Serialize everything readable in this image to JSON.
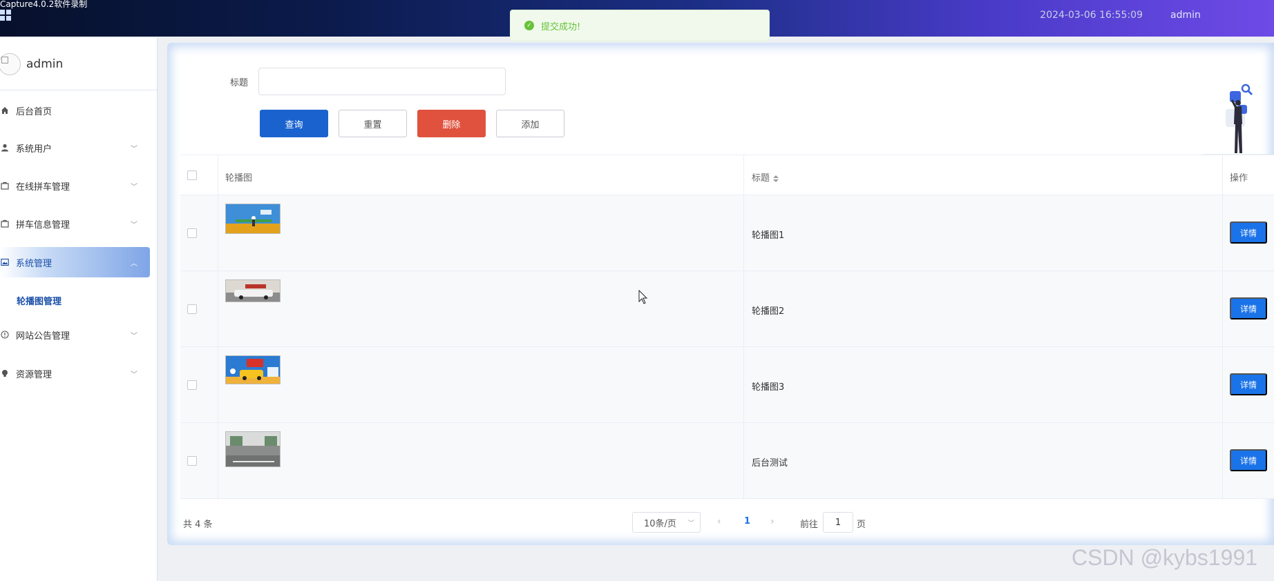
{
  "window": {
    "recorder_label": "Capture4.0.2软件录制",
    "datetime": "2024-03-06 16:55:09",
    "user": "admin"
  },
  "toast": {
    "message": "提交成功!"
  },
  "sidebar": {
    "user_name": "admin",
    "items": [
      {
        "label": "后台首页",
        "icon": "home-icon"
      },
      {
        "label": "系统用户",
        "icon": "user-icon"
      },
      {
        "label": "在线拼车管理",
        "icon": "bag-icon"
      },
      {
        "label": "拼车信息管理",
        "icon": "bag-icon"
      },
      {
        "label": "系统管理",
        "icon": "picture-icon"
      },
      {
        "label": "网站公告管理",
        "icon": "info-icon"
      },
      {
        "label": "资源管理",
        "icon": "bulb-icon"
      }
    ],
    "submenu": {
      "label": "轮播图管理"
    }
  },
  "search": {
    "label": "标题",
    "value": "",
    "placeholder": ""
  },
  "toolbar": {
    "query_label": "查询",
    "reset_label": "重置",
    "delete_label": "删除",
    "add_label": "添加"
  },
  "table": {
    "headers": {
      "image": "轮播图",
      "title": "标题",
      "actions": "操作"
    },
    "rows": [
      {
        "title": "轮播图1",
        "action": "详情"
      },
      {
        "title": "轮播图2",
        "action": "详情"
      },
      {
        "title": "轮播图3",
        "action": "详情"
      },
      {
        "title": "后台测试",
        "action": "详情"
      }
    ]
  },
  "pagination": {
    "total": "共 4 条",
    "page_size": "10条/页",
    "current_page": "1",
    "goto_label": "前往",
    "goto_value": "1",
    "page_suffix": "页"
  },
  "watermark": "CSDN @kybs1991",
  "colors": {
    "primary": "#1a63cf",
    "danger": "#e0523e",
    "success": "#67c23a",
    "detail": "#1a73e8"
  }
}
